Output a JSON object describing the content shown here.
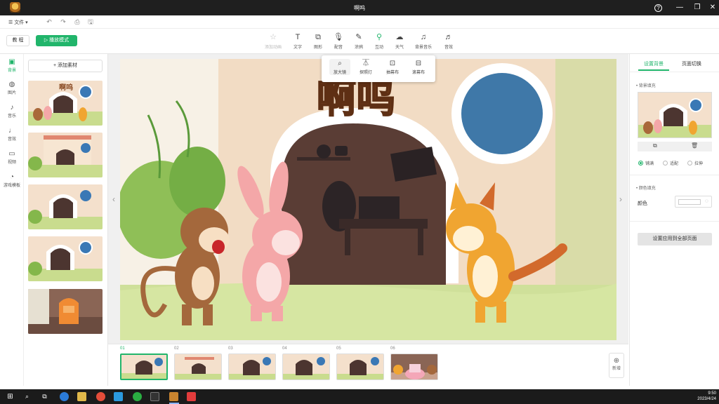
{
  "window": {
    "title": "啊呜"
  },
  "menu": {
    "file_label": "文件"
  },
  "toolbar": {
    "record_label": "教 程",
    "play_label": "播放模式",
    "tools": [
      {
        "label": "添加动画",
        "icon": "star-icon",
        "disabled": true
      },
      {
        "label": "文字",
        "icon": "text-icon"
      },
      {
        "label": "图形",
        "icon": "shape-icon"
      },
      {
        "label": "配音",
        "icon": "microphone-icon"
      },
      {
        "label": "涂鸦",
        "icon": "pen-icon"
      },
      {
        "label": "互动",
        "icon": "interact-icon",
        "active": true
      },
      {
        "label": "天气",
        "icon": "weather-icon"
      },
      {
        "label": "背景音乐",
        "icon": "music-icon"
      },
      {
        "label": "音效",
        "icon": "sound-effect-icon"
      }
    ]
  },
  "popup": {
    "items": [
      {
        "label": "放大镜",
        "icon": "magnifier-icon"
      },
      {
        "label": "探照灯",
        "icon": "spotlight-icon"
      },
      {
        "label": "抽幕布",
        "icon": "curtain-pull-icon"
      },
      {
        "label": "滚幕布",
        "icon": "curtain-roll-icon"
      }
    ]
  },
  "sidebar": {
    "items": [
      {
        "label": "背景",
        "icon": "background-icon",
        "active": true
      },
      {
        "label": "图片",
        "icon": "image-icon"
      },
      {
        "label": "音乐",
        "icon": "music-note-icon"
      },
      {
        "label": "音效",
        "icon": "audio-icon"
      },
      {
        "label": "视频",
        "icon": "video-icon"
      },
      {
        "label": "游戏模板",
        "icon": "game-template-icon"
      }
    ]
  },
  "assets": {
    "add_label": "+ 添加素材"
  },
  "scene": {
    "title_art": "啊呜"
  },
  "right_panel": {
    "tabs": [
      "设置背景",
      "页面切换"
    ],
    "image_fill_label": "背景填充",
    "fill_modes": [
      "铺满",
      "适配",
      "拉伸"
    ],
    "color_fill_label": "颜色填充",
    "color_label": "颜色",
    "color_value": "#ffffff",
    "apply_all_label": "设置应用到全部页面"
  },
  "pages": {
    "numbers": [
      "01",
      "02",
      "03",
      "04",
      "05",
      "06"
    ],
    "active_index": 0,
    "add_label": "新增"
  },
  "taskbar": {
    "time": "9:50",
    "date": "2023/4/24"
  },
  "colors": {
    "accent": "#21b56b",
    "titlebar": "#1f1f1f",
    "taskbar": "#1b1b1b"
  }
}
